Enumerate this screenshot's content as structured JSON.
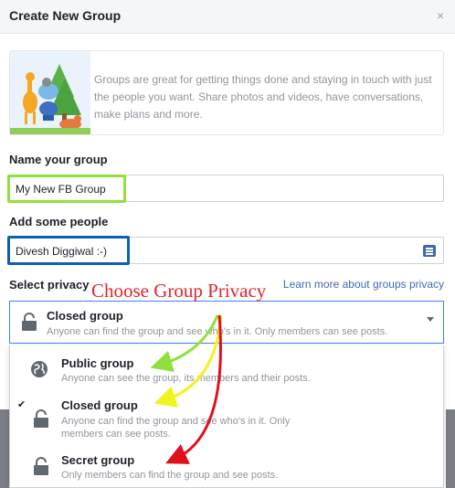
{
  "dialog": {
    "title": "Create New Group",
    "close_icon": "close-icon",
    "close_glyph": "×"
  },
  "intro": {
    "text": "Groups are great for getting things done and staying in touch with just the people you want. Share photos and videos, have conversations, make plans and more."
  },
  "name_section": {
    "label": "Name your group",
    "value": "My New FB Group"
  },
  "people_section": {
    "label": "Add some people",
    "value": "Divesh Diggiwal :-)",
    "icon": "contact-list-icon"
  },
  "privacy_section": {
    "label": "Select privacy",
    "learn_more": "Learn more about groups privacy",
    "annotation": "Choose Group Privacy",
    "selected": {
      "title": "Closed group",
      "description": "Anyone can find the group and see who's in it. Only members can see posts."
    },
    "options": [
      {
        "title": "Public group",
        "description": "Anyone can see the group, its members and their posts.",
        "icon": "globe-icon",
        "checked": false
      },
      {
        "title": "Closed group",
        "description_line1": "Anyone can find the group and see who's in it. Only",
        "description_line2": "members can see posts.",
        "icon": "lock-icon",
        "checked": true,
        "check_glyph": "✔"
      },
      {
        "title": "Secret group",
        "description": "Only members can find the group and see posts.",
        "icon": "lock-icon",
        "checked": false
      }
    ]
  },
  "colors": {
    "highlight_name": "#92e03a",
    "highlight_people": "#0b5fb8",
    "annotation": "#e0242b",
    "arrow_green": "#8fe03a",
    "arrow_yellow": "#f2f21c",
    "arrow_red": "#e0101a",
    "link": "#4267b2"
  }
}
